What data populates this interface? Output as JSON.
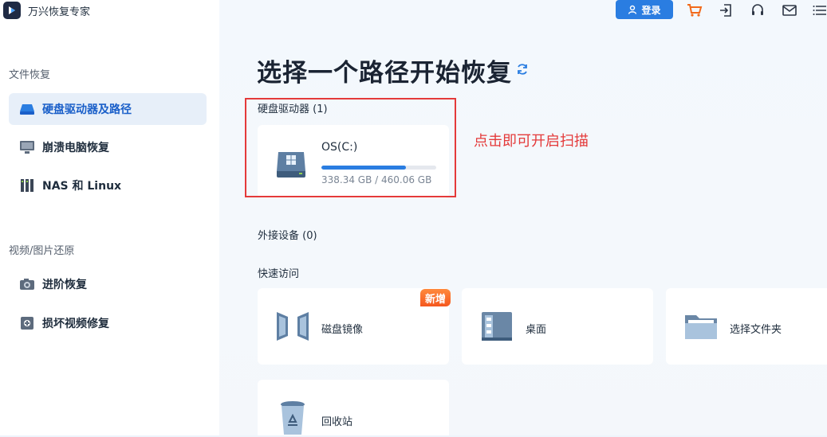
{
  "app": {
    "name": "万兴恢复专家"
  },
  "sidebar": {
    "section_file": "文件恢复",
    "section_media": "视频/图片还原",
    "items": [
      {
        "label": "硬盘驱动器及路径",
        "icon": "hard-drive-icon"
      },
      {
        "label": "崩溃电脑恢复",
        "icon": "monitor-icon"
      },
      {
        "label": "NAS 和 Linux",
        "icon": "nas-icon"
      },
      {
        "label": "进阶恢复",
        "icon": "camera-icon"
      },
      {
        "label": "损坏视频修复",
        "icon": "video-repair-icon"
      }
    ]
  },
  "topbar": {
    "login_label": "登录"
  },
  "main": {
    "title": "选择一个路径开始恢复",
    "drives_heading": "硬盘驱动器 (1)",
    "drive": {
      "name": "OS(C:)",
      "size": "338.34 GB / 460.06 GB",
      "used_fraction": 0.735
    },
    "hint": "点击即可开启扫描",
    "external_heading": "外接设备 (0)",
    "quick_heading": "快速访问",
    "new_badge": "新增",
    "quick": [
      {
        "label": "磁盘镜像",
        "icon": "disk-image-icon"
      },
      {
        "label": "桌面",
        "icon": "desktop-icon"
      },
      {
        "label": "选择文件夹",
        "icon": "folder-icon"
      },
      {
        "label": "回收站",
        "icon": "recycle-bin-icon"
      }
    ]
  },
  "colors": {
    "accent": "#2a7de1",
    "highlight": "#e43a3a",
    "badge": "#f5571e"
  }
}
